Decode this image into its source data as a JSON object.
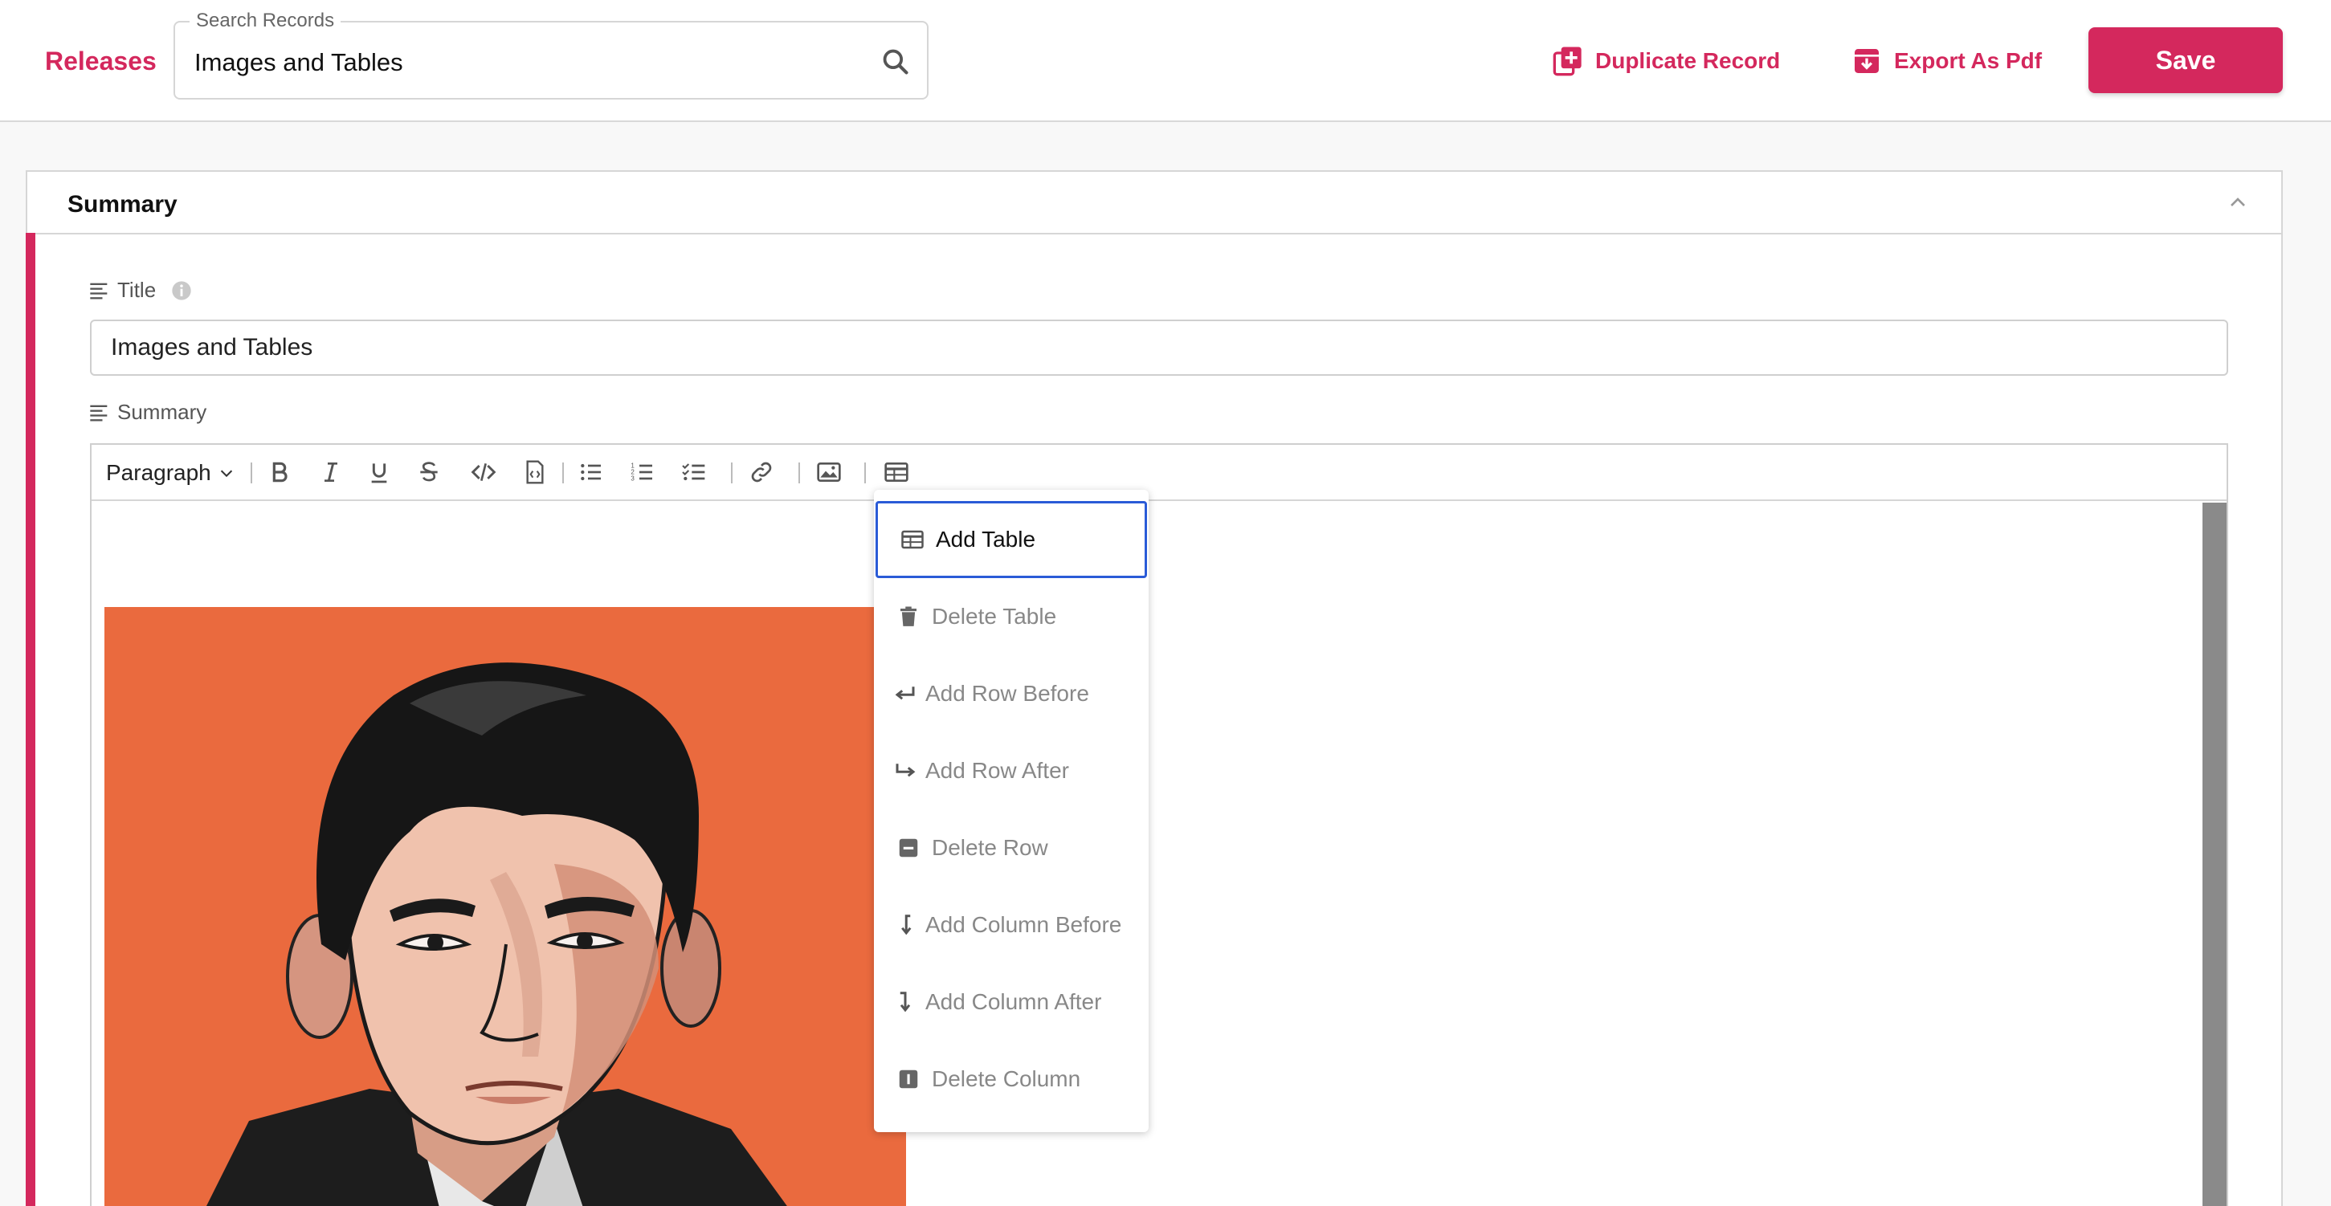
{
  "header": {
    "releases_label": "Releases",
    "search": {
      "legend": "Search Records",
      "value": "Images and Tables"
    },
    "duplicate_label": "Duplicate Record",
    "export_label": "Export As Pdf",
    "save_label": "Save"
  },
  "panel": {
    "title": "Summary",
    "title_field": {
      "label": "Title",
      "value": "Images and Tables"
    },
    "summary_field": {
      "label": "Summary"
    }
  },
  "editor": {
    "block_format": "Paragraph",
    "toolbar_icons": [
      "bold-icon",
      "italic-icon",
      "underline-icon",
      "strikethrough-icon",
      "code-icon",
      "code-block-icon",
      "bullet-list-icon",
      "numbered-list-icon",
      "task-list-icon",
      "link-icon",
      "image-icon",
      "table-icon"
    ]
  },
  "table_menu": {
    "items": [
      {
        "label": "Add Table",
        "icon": "table-icon",
        "enabled": true
      },
      {
        "label": "Delete Table",
        "icon": "trash-icon",
        "enabled": false
      },
      {
        "label": "Add Row Before",
        "icon": "arrow-return-left-icon",
        "enabled": false
      },
      {
        "label": "Add Row After",
        "icon": "arrow-return-right-icon",
        "enabled": false
      },
      {
        "label": "Delete Row",
        "icon": "delete-row-icon",
        "enabled": false
      },
      {
        "label": "Add Column Before",
        "icon": "arrow-down-left-icon",
        "enabled": false
      },
      {
        "label": "Add Column After",
        "icon": "arrow-down-right-icon",
        "enabled": false
      },
      {
        "label": "Delete Column",
        "icon": "delete-column-icon",
        "enabled": false
      }
    ]
  },
  "colors": {
    "brand": "#d4285d",
    "focus": "#2a5bd7",
    "disabled_text": "#888888",
    "portrait_background": "#ea6a3e"
  }
}
